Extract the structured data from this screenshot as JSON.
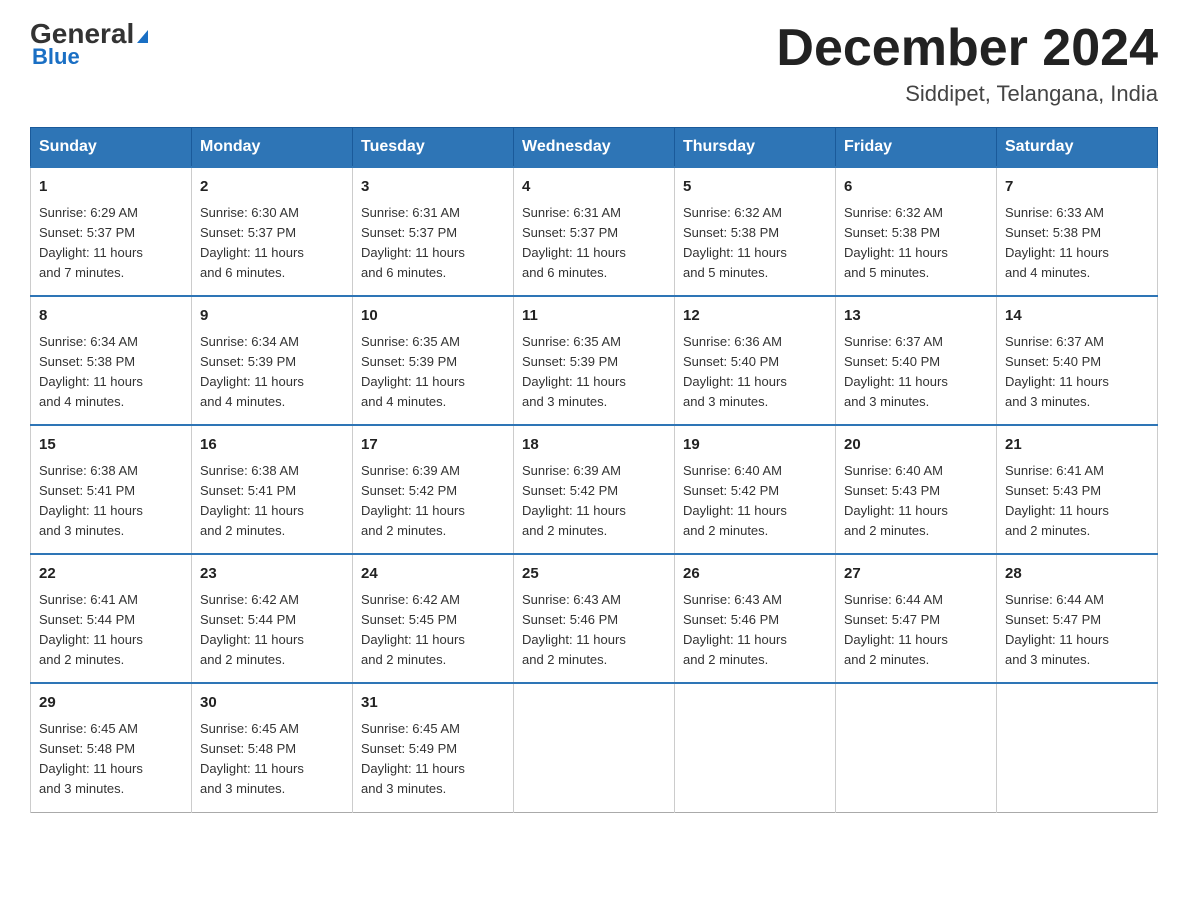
{
  "logo": {
    "general": "General",
    "blue": "Blue",
    "triangle": "▶"
  },
  "title": {
    "month_year": "December 2024",
    "location": "Siddipet, Telangana, India"
  },
  "weekdays": [
    "Sunday",
    "Monday",
    "Tuesday",
    "Wednesday",
    "Thursday",
    "Friday",
    "Saturday"
  ],
  "weeks": [
    [
      {
        "day": "1",
        "sunrise": "6:29 AM",
        "sunset": "5:37 PM",
        "daylight": "11 hours and 7 minutes."
      },
      {
        "day": "2",
        "sunrise": "6:30 AM",
        "sunset": "5:37 PM",
        "daylight": "11 hours and 6 minutes."
      },
      {
        "day": "3",
        "sunrise": "6:31 AM",
        "sunset": "5:37 PM",
        "daylight": "11 hours and 6 minutes."
      },
      {
        "day": "4",
        "sunrise": "6:31 AM",
        "sunset": "5:37 PM",
        "daylight": "11 hours and 6 minutes."
      },
      {
        "day": "5",
        "sunrise": "6:32 AM",
        "sunset": "5:38 PM",
        "daylight": "11 hours and 5 minutes."
      },
      {
        "day": "6",
        "sunrise": "6:32 AM",
        "sunset": "5:38 PM",
        "daylight": "11 hours and 5 minutes."
      },
      {
        "day": "7",
        "sunrise": "6:33 AM",
        "sunset": "5:38 PM",
        "daylight": "11 hours and 4 minutes."
      }
    ],
    [
      {
        "day": "8",
        "sunrise": "6:34 AM",
        "sunset": "5:38 PM",
        "daylight": "11 hours and 4 minutes."
      },
      {
        "day": "9",
        "sunrise": "6:34 AM",
        "sunset": "5:39 PM",
        "daylight": "11 hours and 4 minutes."
      },
      {
        "day": "10",
        "sunrise": "6:35 AM",
        "sunset": "5:39 PM",
        "daylight": "11 hours and 4 minutes."
      },
      {
        "day": "11",
        "sunrise": "6:35 AM",
        "sunset": "5:39 PM",
        "daylight": "11 hours and 3 minutes."
      },
      {
        "day": "12",
        "sunrise": "6:36 AM",
        "sunset": "5:40 PM",
        "daylight": "11 hours and 3 minutes."
      },
      {
        "day": "13",
        "sunrise": "6:37 AM",
        "sunset": "5:40 PM",
        "daylight": "11 hours and 3 minutes."
      },
      {
        "day": "14",
        "sunrise": "6:37 AM",
        "sunset": "5:40 PM",
        "daylight": "11 hours and 3 minutes."
      }
    ],
    [
      {
        "day": "15",
        "sunrise": "6:38 AM",
        "sunset": "5:41 PM",
        "daylight": "11 hours and 3 minutes."
      },
      {
        "day": "16",
        "sunrise": "6:38 AM",
        "sunset": "5:41 PM",
        "daylight": "11 hours and 2 minutes."
      },
      {
        "day": "17",
        "sunrise": "6:39 AM",
        "sunset": "5:42 PM",
        "daylight": "11 hours and 2 minutes."
      },
      {
        "day": "18",
        "sunrise": "6:39 AM",
        "sunset": "5:42 PM",
        "daylight": "11 hours and 2 minutes."
      },
      {
        "day": "19",
        "sunrise": "6:40 AM",
        "sunset": "5:42 PM",
        "daylight": "11 hours and 2 minutes."
      },
      {
        "day": "20",
        "sunrise": "6:40 AM",
        "sunset": "5:43 PM",
        "daylight": "11 hours and 2 minutes."
      },
      {
        "day": "21",
        "sunrise": "6:41 AM",
        "sunset": "5:43 PM",
        "daylight": "11 hours and 2 minutes."
      }
    ],
    [
      {
        "day": "22",
        "sunrise": "6:41 AM",
        "sunset": "5:44 PM",
        "daylight": "11 hours and 2 minutes."
      },
      {
        "day": "23",
        "sunrise": "6:42 AM",
        "sunset": "5:44 PM",
        "daylight": "11 hours and 2 minutes."
      },
      {
        "day": "24",
        "sunrise": "6:42 AM",
        "sunset": "5:45 PM",
        "daylight": "11 hours and 2 minutes."
      },
      {
        "day": "25",
        "sunrise": "6:43 AM",
        "sunset": "5:46 PM",
        "daylight": "11 hours and 2 minutes."
      },
      {
        "day": "26",
        "sunrise": "6:43 AM",
        "sunset": "5:46 PM",
        "daylight": "11 hours and 2 minutes."
      },
      {
        "day": "27",
        "sunrise": "6:44 AM",
        "sunset": "5:47 PM",
        "daylight": "11 hours and 2 minutes."
      },
      {
        "day": "28",
        "sunrise": "6:44 AM",
        "sunset": "5:47 PM",
        "daylight": "11 hours and 3 minutes."
      }
    ],
    [
      {
        "day": "29",
        "sunrise": "6:45 AM",
        "sunset": "5:48 PM",
        "daylight": "11 hours and 3 minutes."
      },
      {
        "day": "30",
        "sunrise": "6:45 AM",
        "sunset": "5:48 PM",
        "daylight": "11 hours and 3 minutes."
      },
      {
        "day": "31",
        "sunrise": "6:45 AM",
        "sunset": "5:49 PM",
        "daylight": "11 hours and 3 minutes."
      },
      null,
      null,
      null,
      null
    ]
  ],
  "labels": {
    "sunrise": "Sunrise:",
    "sunset": "Sunset:",
    "daylight": "Daylight:"
  }
}
